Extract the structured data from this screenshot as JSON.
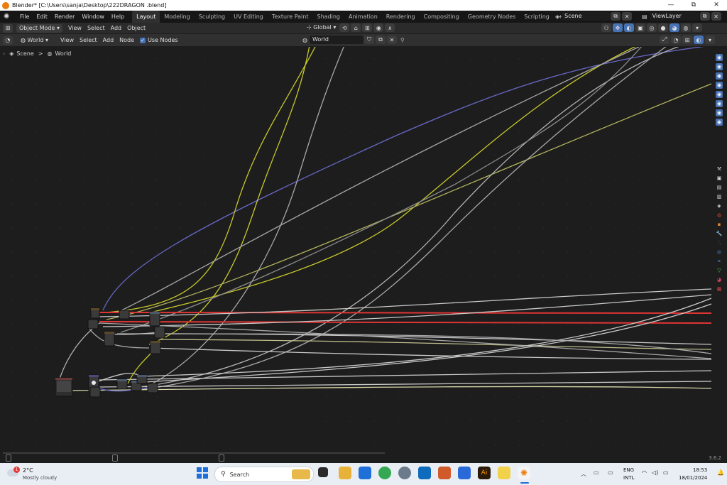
{
  "window": {
    "title": "Blender* [C:\\Users\\sanja\\Desktop\\222DRAGON .blend]",
    "minimize": "—",
    "maximize": "⧉",
    "close": "✕"
  },
  "menubar": {
    "items": [
      "File",
      "Edit",
      "Render",
      "Window",
      "Help"
    ],
    "workspaces": [
      "Layout",
      "Modeling",
      "Sculpting",
      "UV Editing",
      "Texture Paint",
      "Shading",
      "Animation",
      "Rendering",
      "Compositing",
      "Geometry Nodes",
      "Scripting"
    ],
    "active_workspace": "Layout",
    "add_workspace": "+",
    "scene": "Scene",
    "view_layer": "ViewLayer"
  },
  "viewport_header": {
    "mode": "Object Mode",
    "menus": [
      "View",
      "Select",
      "Add",
      "Object"
    ],
    "orientation": "Global"
  },
  "node_header": {
    "shader_type": "World",
    "menus": [
      "View",
      "Select",
      "Add",
      "Node"
    ],
    "use_nodes_label": "Use Nodes",
    "use_nodes_checked": true,
    "world_name": "World"
  },
  "breadcrumb": {
    "scene": "Scene",
    "separator": ">",
    "world": "World"
  },
  "status": {
    "version": "3.6.2"
  },
  "taskbar": {
    "weather_temp": "2°C",
    "weather_desc": "Mostly cloudy",
    "weather_badge": "1",
    "search_placeholder": "Search",
    "language": "ENG",
    "layout": "INTL",
    "time": "18:53",
    "date": "18/01/2024"
  },
  "colors": {
    "accent": "#4772b3",
    "blender_orange": "#e87d0d",
    "wire_yellow": "#c7c729",
    "wire_gray": "#a1a1a1",
    "wire_red": "#e23434",
    "wire_purple": "#6363c7"
  }
}
